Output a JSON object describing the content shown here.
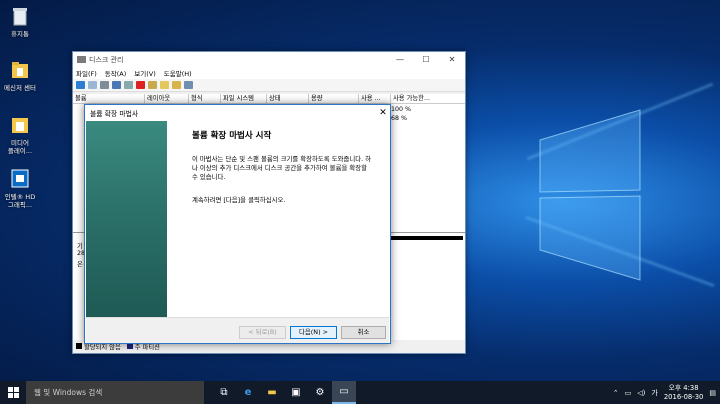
{
  "desktop": {
    "icons": [
      {
        "label": "휴지통",
        "icon": "recycle-bin-icon"
      },
      {
        "label": "메신저 센터",
        "icon": "folder-icon"
      },
      {
        "label": "미디어\n플레이...",
        "icon": "media-player-icon"
      },
      {
        "label": "인텔® HD\n그래픽...",
        "icon": "intel-graphics-icon"
      }
    ]
  },
  "disk_window": {
    "title": "디스크 관리",
    "controls": {
      "minimize": "—",
      "maximize": "☐",
      "close": "✕"
    },
    "menu": [
      "파일(F)",
      "동작(A)",
      "보기(V)",
      "도움말(H)"
    ],
    "columns": [
      "볼륨",
      "레이아웃",
      "형식",
      "파일 시스템",
      "상태",
      "용량",
      "사용 ...",
      "사용 가능한..."
    ],
    "rows": [
      {
        "pct1": "",
        "pct2": "100 %"
      },
      {
        "pct1": "",
        "pct2": "68 %"
      }
    ],
    "lower_labels": [
      "기",
      "28",
      "온"
    ],
    "legend": [
      {
        "label": "할당되지 않음",
        "color": "#000000"
      },
      {
        "label": "주 파티션",
        "color": "#1a237e"
      }
    ]
  },
  "wizard": {
    "title": "볼륨 확장 마법사",
    "close": "✕",
    "heading": "볼륨 확장 마법사 시작",
    "paragraph1": "이 마법사는 단순 및 스팬 볼륨의 크기를 확장하도록 도와줍니다. 하나 이상의 추가 디스크에서 디스크 공간을 추가하여 볼륨을 확장할 수 있습니다.",
    "paragraph2": "계속하려면 [다음]을 클릭하십시오.",
    "buttons": {
      "back": "< 뒤로(B)",
      "next": "다음(N) >",
      "cancel": "취소"
    }
  },
  "taskbar": {
    "search_placeholder": "웹 및 Windows 검색",
    "time": "오후 4:38",
    "date": "2016-08-30"
  },
  "colors": {
    "accent": "#0078d7",
    "wizard_side": "#2a6f68",
    "taskbar": "#101a28"
  }
}
